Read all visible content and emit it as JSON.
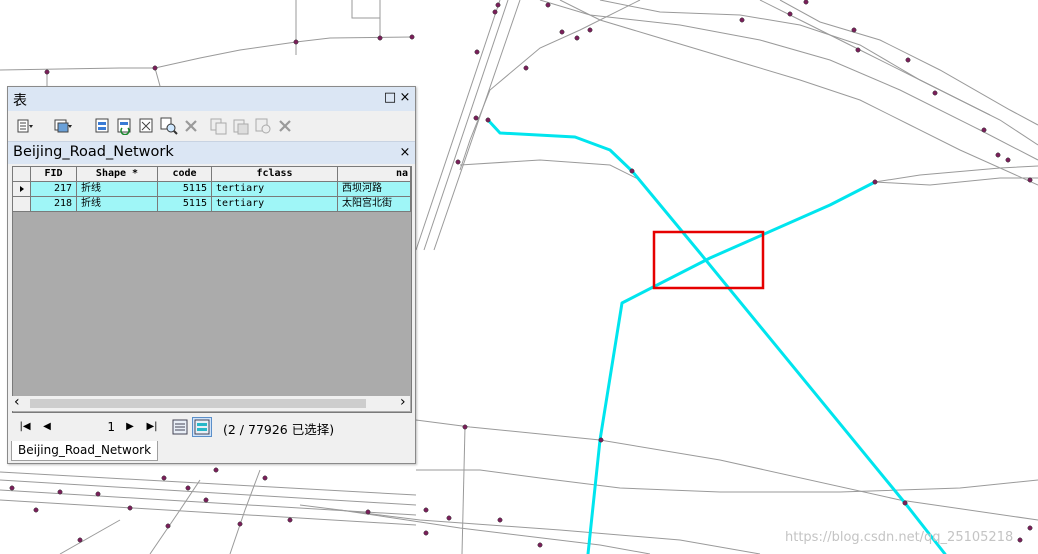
{
  "window": {
    "title": "表",
    "minimize_glyph": "□",
    "close_glyph": "×"
  },
  "toolbar": {
    "icons": [
      "table-options-icon",
      "related-tables-icon",
      "select-by-attributes-icon",
      "switch-selection-icon",
      "clear-selection-icon",
      "zoom-to-selected-icon",
      "delete-selected-icon",
      "copy-selected-icon",
      "paste-icon",
      "paste-special-icon",
      "delete-icon"
    ]
  },
  "layer": {
    "name": "Beijing_Road_Network",
    "close_glyph": "×"
  },
  "table": {
    "columns": [
      "FID",
      "Shape *",
      "code",
      "fclass",
      "na"
    ],
    "rows": [
      {
        "fid": "217",
        "shape": "折线",
        "code": "5115",
        "fclass": "tertiary",
        "name": "西坝河路",
        "active": true
      },
      {
        "fid": "218",
        "shape": "折线",
        "code": "5115",
        "fclass": "tertiary",
        "name": "太阳宫北街",
        "active": false
      }
    ]
  },
  "scroll": {
    "left_glyph": "‹",
    "right_glyph": "›"
  },
  "nav": {
    "first_glyph": "|◀",
    "prev_glyph": "◀",
    "page": "1",
    "next_glyph": "▶",
    "last_glyph": "▶|",
    "status": "(2 / 77926 已选择)"
  },
  "tab_label": "Beijing_Road_Network",
  "watermark": "https://blog.csdn.net/qq_25105218",
  "colors": {
    "selected_road": "#00e5ee",
    "road": "#9a9a9a",
    "vertex": "#7a1f5a",
    "highlight_box": "#e60000",
    "selected_row": "#9ff6f7",
    "title_bar": "#dbe6f4"
  }
}
